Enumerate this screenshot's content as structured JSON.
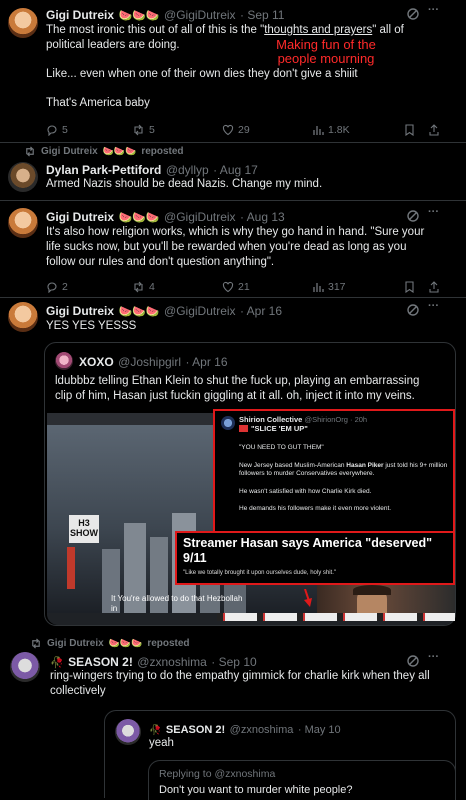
{
  "tweet1": {
    "name": "Gigi Dutreix",
    "emoji": "🍉🍉🍉",
    "handle": "@GigiDutreix",
    "time": "· Sep 11",
    "line1_pre": "The most ironic this out of all of this is the \"",
    "line1_link": "thoughts and prayers",
    "line1_post": "\" all of",
    "line2": "political leaders are doing.",
    "para2": "Like... even when one of their own dies they don't give a shiiit",
    "para3": "That's America baby",
    "annotation_line1": "Making fun of the",
    "annotation_line2": "people mourning",
    "replies": "5",
    "reposts": "5",
    "likes": "29",
    "views": "1.8K"
  },
  "repost1": {
    "label": "Gigi Dutreix",
    "emoji": "🍉🍉🍉",
    "suffix": "reposted"
  },
  "tweet2": {
    "name": "Dylan Park-Pettiford",
    "handle": "@dyllyp",
    "time": "· Aug 17",
    "text": "Armed Nazis should be dead Nazis. Change my mind."
  },
  "tweet3": {
    "name": "Gigi Dutreix",
    "emoji": "🍉🍉🍉",
    "handle": "@GigiDutreix",
    "time": "· Aug 13",
    "line1": "It's also how religion works, which is why they go hand in hand. \"Sure your",
    "line2": "life sucks now, but you'll be rewarded when you're dead as long as you",
    "line3": "follow our rules and don't question anything\".",
    "replies": "2",
    "reposts": "4",
    "likes": "21",
    "views": "317"
  },
  "tweet4": {
    "name": "Gigi Dutreix",
    "emoji": "🍉🍉🍉",
    "handle": "@GigiDutreix",
    "time": "· Apr 16",
    "text": "YES YES YESSS"
  },
  "quote4": {
    "name": "XOXO",
    "handle": "@Joshipgirl",
    "time": "· Apr 16",
    "line1": "ldubbbz telling Ethan Klein to shut the fuck up, playing an embarrassing",
    "line2": "clip of him, Hasan just fuckin giggling at it all. oh, inject it into my veins."
  },
  "media": {
    "overlay_name": "Shirion Collective",
    "overlay_handle": "@ShirionOrg · 20h",
    "overlay_tag": "\"SLICE 'EM UP\"",
    "overlay_quote": "\"YOU NEED TO GUT THEM\"",
    "overlay_p1_a": "New Jersey based Muslim-American ",
    "overlay_p1_bold": "Hasan Piker",
    "overlay_p1_b": " just told his 9+ million",
    "overlay_p1_c": "followers to murder Conservatives everywhere.",
    "overlay_p2": "He wasn't satisfied with how Charlie Kirk died.",
    "overlay_p3": "He demands his followers make it even more violent.",
    "headline_1": "Streamer Hasan says America \"deserved\"",
    "headline_2": "9/11",
    "headline_sub": "\"Like we totally brought it upon ourselves dude, holy shit.\"",
    "logo_text": "H3 SHOW",
    "caption_1": "It You're allowed to do that Hezbollah",
    "caption_2": "in"
  },
  "repost2": {
    "label": "Gigi Dutreix",
    "emoji": "🍉🍉🍉",
    "suffix": "reposted"
  },
  "tweet5": {
    "name": "SEASON 2!",
    "handle": "@zxnoshima",
    "time": "· Sep 10",
    "line1": "ring-wingers trying to do the empathy gimmick for charlie kirk when they all",
    "line2": "collectively"
  },
  "quote5": {
    "name": "SEASON 2!",
    "handle": "@zxnoshima",
    "time": "· May 10",
    "text": "yeah"
  },
  "inner_quote": {
    "replying": "Replying to @zxnoshima",
    "text": "Don't you want to murder white people?"
  }
}
